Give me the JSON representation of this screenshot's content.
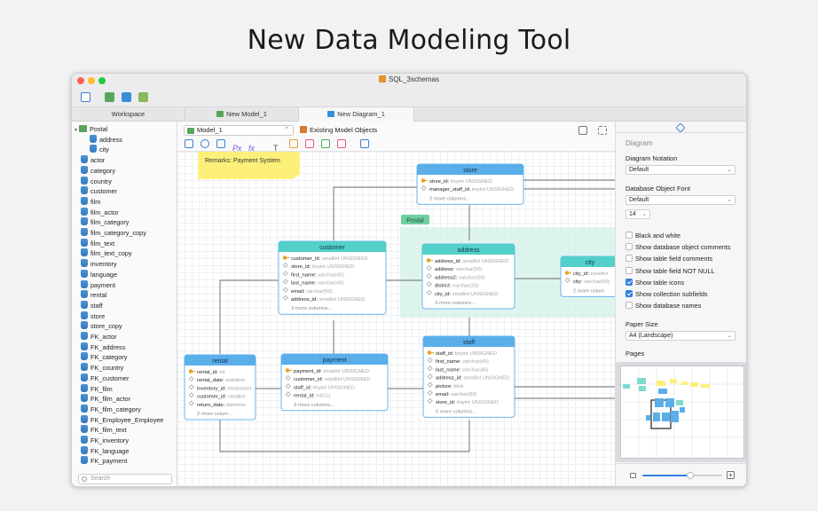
{
  "headline": "New Data Modeling Tool",
  "window": {
    "title": "SQL_3schemas"
  },
  "tabs": [
    {
      "label": "Workspace"
    },
    {
      "label": "New Model_1"
    },
    {
      "label": "New Diagram_1"
    }
  ],
  "sidebar": {
    "schema": "Postal",
    "schema_children": [
      "address",
      "city"
    ],
    "tables": [
      "actor",
      "category",
      "country",
      "customer",
      "film",
      "film_actor",
      "film_category",
      "film_category_copy",
      "film_text",
      "film_text_copy",
      "inventory",
      "language",
      "payment",
      "rental",
      "staff",
      "store",
      "store_copy",
      "FK_actor",
      "FK_address",
      "FK_category",
      "FK_country",
      "FK_customer",
      "FK_film",
      "FK_film_actor",
      "FK_film_category",
      "FK_Employee_Employee",
      "FK_film_text",
      "FK_inventory",
      "FK_language",
      "FK_payment"
    ],
    "search_placeholder": "Search"
  },
  "main": {
    "model_select": "Model_1",
    "existing_objects": "Existing Model Objects"
  },
  "diagram": {
    "note": "Remarks: Payment System",
    "group_label": "Postal",
    "tables": [
      {
        "name": "store",
        "cols": [
          [
            "store_id:",
            "tinyint UNSIGNED"
          ],
          [
            "manager_staff_id:",
            "tinyint UNSIGNED"
          ]
        ],
        "more": "2 more columns..."
      },
      {
        "name": "customer",
        "cols": [
          [
            "customer_id:",
            "smallint UNSIGNED"
          ],
          [
            "store_id:",
            "tinyint UNSIGNED"
          ],
          [
            "first_name:",
            "varchar(45)"
          ],
          [
            "last_name:",
            "varchar(45)"
          ],
          [
            "email:",
            "varchar(50)"
          ],
          [
            "address_id:",
            "smallint UNSIGNED"
          ]
        ],
        "more": "3 more columns..."
      },
      {
        "name": "address",
        "cols": [
          [
            "address_id:",
            "smallint UNSIGNED"
          ],
          [
            "address:",
            "varchar(50)"
          ],
          [
            "address2:",
            "varchar(50)"
          ],
          [
            "district:",
            "varchar(20)"
          ],
          [
            "city_id:",
            "smallint UNSIGNED"
          ]
        ],
        "more": "3 more columns..."
      },
      {
        "name": "city",
        "cols": [
          [
            "city_id:",
            "smallint"
          ],
          [
            "city:",
            "varchar(50)"
          ]
        ],
        "more": "2 more colum"
      },
      {
        "name": "rental",
        "cols": [
          [
            "rental_id:",
            "int"
          ],
          [
            "rental_date:",
            "datetime"
          ],
          [
            "inventory_id:",
            "mediumint"
          ],
          [
            "customer_id:",
            "smallint"
          ],
          [
            "return_date:",
            "datetime"
          ]
        ],
        "more": "2 more colum..."
      },
      {
        "name": "payment",
        "cols": [
          [
            "payment_id:",
            "smallint UNSIGNED"
          ],
          [
            "customer_id:",
            "smallint UNSIGNED"
          ],
          [
            "staff_id:",
            "tinyint UNSIGNED"
          ],
          [
            "rental_id:",
            "int(11)"
          ]
        ],
        "more": "3 more columns..."
      },
      {
        "name": "staff",
        "cols": [
          [
            "staff_id:",
            "tinyint UNSIGNED"
          ],
          [
            "first_name:",
            "varchar(45)"
          ],
          [
            "last_name:",
            "varchar(45)"
          ],
          [
            "address_id:",
            "smallint UNSIGNED"
          ],
          [
            "picture:",
            "blob"
          ],
          [
            "email:",
            "varchar(50)"
          ],
          [
            "store_id:",
            "tinyint UNSIGNED"
          ]
        ],
        "more": "5 more columns..."
      }
    ]
  },
  "props": {
    "section": "Diagram",
    "notation_label": "Diagram Notation",
    "notation_value": "Default",
    "font_label": "Database Object Font",
    "font_value": "Default",
    "font_size": "14",
    "checkboxes": [
      {
        "label": "Black and white",
        "checked": false
      },
      {
        "label": "Show database object comments",
        "checked": false
      },
      {
        "label": "Show table field comments",
        "checked": false
      },
      {
        "label": "Show table field NOT NULL",
        "checked": false
      },
      {
        "label": "Show table icons",
        "checked": true
      },
      {
        "label": "Show collection subfields",
        "checked": true
      },
      {
        "label": "Show database names",
        "checked": false
      }
    ],
    "paper_label": "Paper Size",
    "paper_value": "A4 (Landscape)",
    "pages_label": "Pages",
    "zoom_level": 0.6
  },
  "colors": {
    "table_header_blue": "#5aaeea",
    "table_header_teal": "#52d0c9",
    "note_yellow": "#fdf07a",
    "accent": "#2f7fe0"
  }
}
